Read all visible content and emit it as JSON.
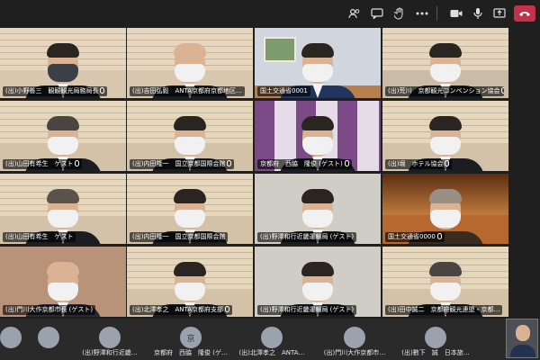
{
  "toolbar": {
    "icons": [
      "people-icon",
      "chat-icon",
      "raise-hand-icon",
      "react-icon",
      "more-icon",
      "camera-icon",
      "mic-icon",
      "share-icon"
    ],
    "leave_label": "退出"
  },
  "tiles": [
    {
      "name": "(出)小野善三　観観観光局務局長",
      "bg": "#d8c6ae"
    },
    {
      "name": "(出)吉田弘毅　ANTA京都府京都地区…",
      "bg": "#d8c6ae"
    },
    {
      "name": "国土交通省0001",
      "bg": "#d1d5dd"
    },
    {
      "name": "(出)荒川　京都観光コンベンション協会",
      "bg": "#c9bba6"
    },
    {
      "name": "(出)山田有希生　ゲスト",
      "bg": "#d4c2a8"
    },
    {
      "name": "(出)内田隆一　国立京都国際会館",
      "bg": "#d4c2a8"
    },
    {
      "name": "京都府　西脇　隆俊 (ゲスト)",
      "bg": "#7c4a86"
    },
    {
      "name": "(出)堀　ホテル協会",
      "bg": "#d4c2a8"
    },
    {
      "name": "(出)門川大作京都市長 (ゲスト)",
      "bg": "#b8937a"
    },
    {
      "name": "(出)北澤孝之　ANTA京都府支部",
      "bg": "#d4c2a8"
    },
    {
      "name": "(出)野澤和行近畿運輸局 (ゲスト)",
      "bg": "#d0cdc6"
    },
    {
      "name": "国土交通省0000",
      "bg": "#b6682f"
    }
  ],
  "tile_last_row_extra": {
    "name": "(出)田中誠二　京都府観光連盟・京都…",
    "bg": "#d4c2a8"
  },
  "strip": {
    "participants": [
      {
        "name": "",
        "initial": ""
      },
      {
        "name": "",
        "initial": ""
      },
      {
        "name": "(出)野澤和行近畿…",
        "initial": ""
      },
      {
        "name": "京都府　西脇　隆俊 (ゲ…",
        "initial": "京"
      },
      {
        "name": "(出)北澤孝之　ANTA…",
        "initial": ""
      },
      {
        "name": "(出)門川大作京都市…",
        "initial": ""
      },
      {
        "name": "(出)數下　誠　日本旅…",
        "initial": ""
      }
    ]
  }
}
